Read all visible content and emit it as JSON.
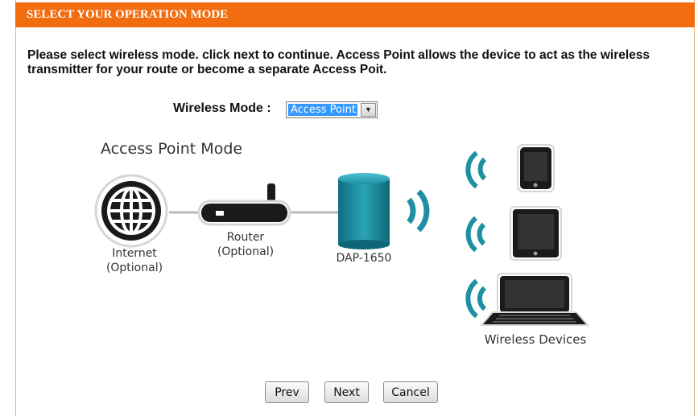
{
  "header": {
    "title": "SELECT YOUR OPERATION MODE"
  },
  "instructions": "Please select wireless mode. click next to continue. Access Point allows the device to act as the wireless transmitter for your route or become a separate Access Poit.",
  "wireless_mode": {
    "label": "Wireless Mode :",
    "selected": "Access Point"
  },
  "diagram": {
    "title": "Access Point Mode",
    "internet_line1": "Internet",
    "internet_line2": "(Optional)",
    "router_line1": "Router",
    "router_line2": "(Optional)",
    "device": "DAP-1650",
    "devices_label": "Wireless Devices"
  },
  "buttons": {
    "prev": "Prev",
    "next": "Next",
    "cancel": "Cancel"
  },
  "colors": {
    "header": "#f26d10",
    "device_teal": "#1f8fa3",
    "icon_dark": "#1a1a1a",
    "select_highlight": "#3399ff"
  }
}
